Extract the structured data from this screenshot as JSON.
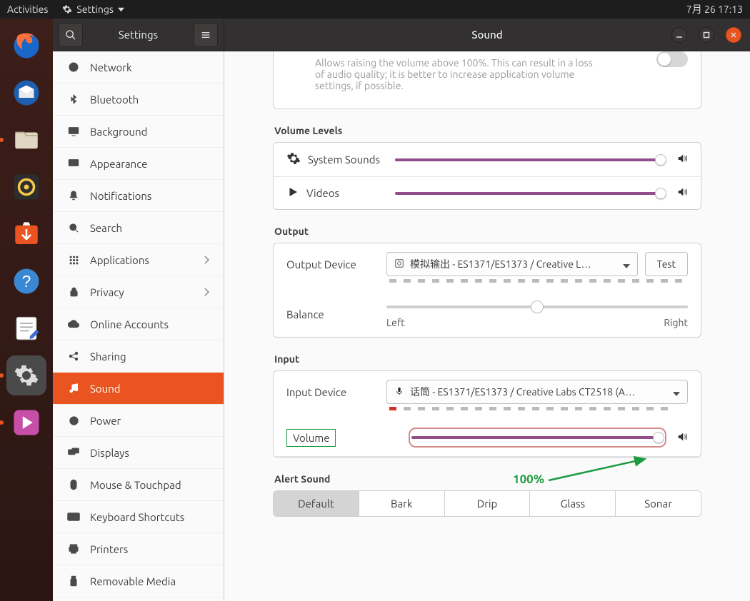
{
  "topbar": {
    "activities": "Activities",
    "app_menu": "Settings",
    "clock": "7月 26  17:13"
  },
  "titlebar": {
    "sidebar_title": "Settings",
    "content_title": "Sound"
  },
  "sidebar": {
    "items": [
      {
        "label": "Network"
      },
      {
        "label": "Bluetooth"
      },
      {
        "label": "Background"
      },
      {
        "label": "Appearance"
      },
      {
        "label": "Notifications"
      },
      {
        "label": "Search"
      },
      {
        "label": "Applications",
        "chevron": true
      },
      {
        "label": "Privacy",
        "chevron": true
      },
      {
        "label": "Online Accounts"
      },
      {
        "label": "Sharing"
      },
      {
        "label": "Sound",
        "selected": true
      },
      {
        "label": "Power"
      },
      {
        "label": "Displays"
      },
      {
        "label": "Mouse & Touchpad"
      },
      {
        "label": "Keyboard Shortcuts"
      },
      {
        "label": "Printers"
      },
      {
        "label": "Removable Media"
      }
    ]
  },
  "overamp_desc": "Allows raising the volume above 100%. This can result in a loss of audio quality; it is better to increase application volume settings, if possible.",
  "sections": {
    "volume_levels": "Volume Levels",
    "output": "Output",
    "input": "Input",
    "alert_sound": "Alert Sound"
  },
  "volume_levels": {
    "system_sounds": "System Sounds",
    "videos": "Videos"
  },
  "output": {
    "device_label": "Output Device",
    "device_value": "模拟输出 - ES1371/ES1373 / Creative L…",
    "test": "Test",
    "balance_label": "Balance",
    "left": "Left",
    "right": "Right"
  },
  "input": {
    "device_label": "Input Device",
    "device_value": "话筒 - ES1371/ES1373 / Creative Labs CT2518 (A…",
    "volume_label": "Volume"
  },
  "annotation_pct": "100%",
  "alert_sounds": [
    "Default",
    "Bark",
    "Drip",
    "Glass",
    "Sonar"
  ]
}
